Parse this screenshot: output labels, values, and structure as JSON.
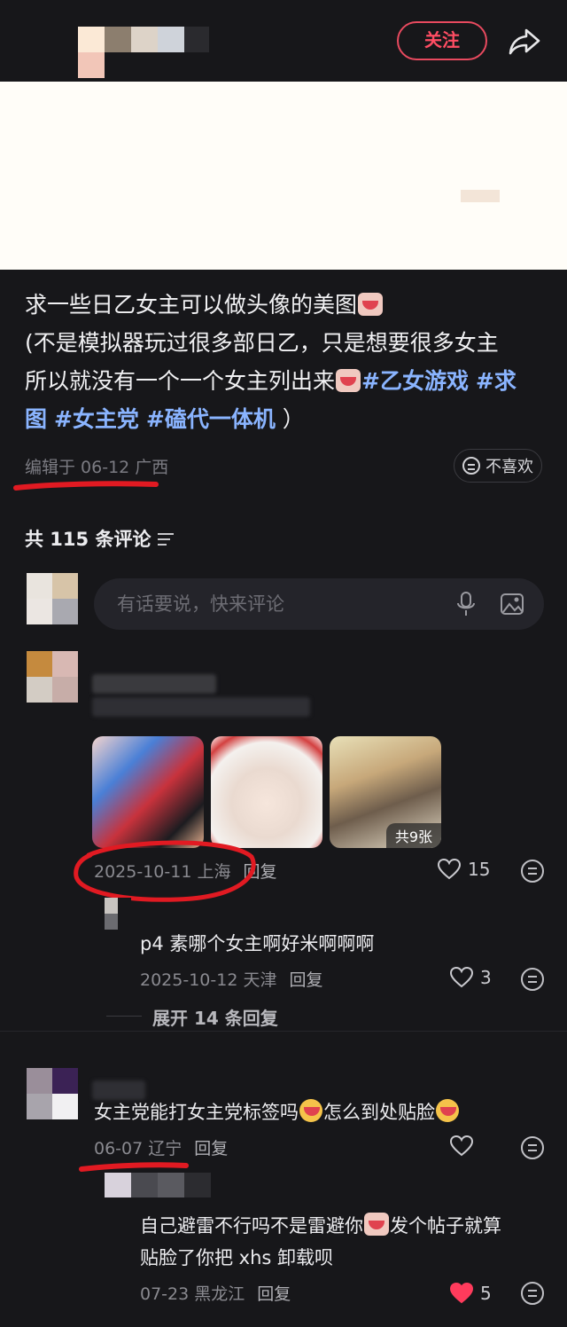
{
  "header": {
    "follow_label": "关注",
    "share_icon": "share-arrow-icon"
  },
  "post": {
    "line1": "求一些日乙女主可以做头像的美图",
    "line2": "(不是模拟器玩过很多部日乙，只是想要很多女主",
    "line3a": "所以就没有一个一个女主列出来",
    "tag1": "#乙女游戏",
    "tag2": "#求",
    "line4_tag2_cont": "图",
    "tag3": "#女主党",
    "tag4": "#磕代一体机",
    "line4_end": "）",
    "edited": "编辑于 06-12 广西",
    "dislike_label": "不喜欢"
  },
  "comments_header": {
    "count_label": "共 115 条评论",
    "input_placeholder": "有话要说，快来评论"
  },
  "comments": [
    {
      "images_count": "共9张",
      "date_loc": "2025-10-11 上海",
      "reply_label": "回复",
      "likes": "15",
      "replies": [
        {
          "text": "p4 素哪个女主啊好米啊啊啊",
          "date_loc": "2025-10-12 天津",
          "reply_label": "回复",
          "likes": "3"
        }
      ],
      "expand_label": "展开 14 条回复"
    },
    {
      "text_a": "女主党能打女主党标签吗",
      "text_b": "怎么到处贴脸",
      "date_loc": "06-07 辽宁",
      "reply_label": "回复",
      "replies": [
        {
          "text_a": "自己避雷不行吗不是雷避你",
          "text_b": "发个帖子就算",
          "text_c": "贴脸了你把 xhs 卸载呗",
          "date_loc": "07-23 黑龙江",
          "reply_label": "回复",
          "likes": "5",
          "liked": true
        }
      ]
    }
  ],
  "colors": {
    "accent": "#ff4d63",
    "hashtag": "#8ab4ff",
    "background": "#17171a",
    "liked_heart": "#ff3b5c"
  }
}
